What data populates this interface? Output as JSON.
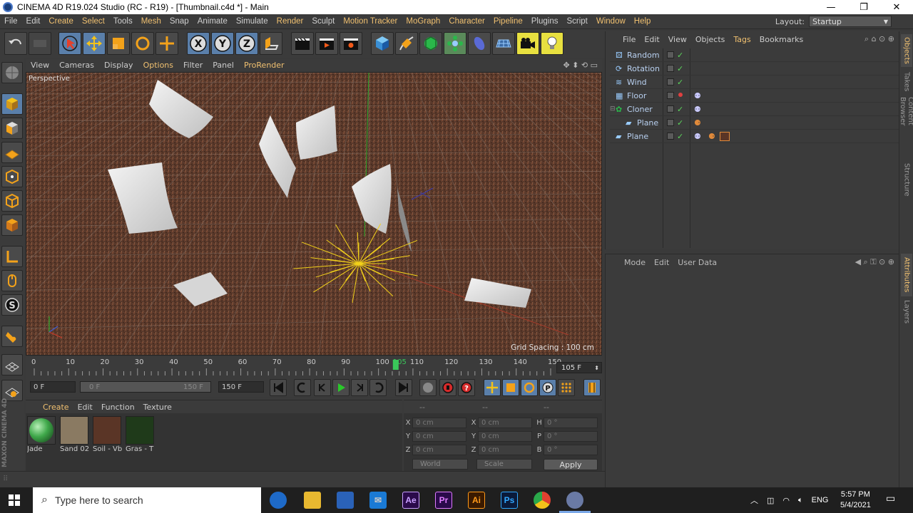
{
  "window": {
    "title": "CINEMA 4D R19.024 Studio (RC - R19) - [Thumbnail.c4d *] - Main",
    "min": "—",
    "max": "❐",
    "close": "✕"
  },
  "menu": {
    "items": [
      "File",
      "Edit",
      "Create",
      "Select",
      "Tools",
      "Mesh",
      "Snap",
      "Animate",
      "Simulate",
      "Render",
      "Sculpt",
      "Motion Tracker",
      "MoGraph",
      "Character",
      "Pipeline",
      "Plugins",
      "Script",
      "Window",
      "Help"
    ],
    "layout_label": "Layout:",
    "layout_value": "Startup"
  },
  "viewport": {
    "menu": [
      "View",
      "Cameras",
      "Display",
      "Options",
      "Filter",
      "Panel",
      "ProRender"
    ],
    "camera_label": "Perspective",
    "grid_spacing": "Grid Spacing : 100 cm"
  },
  "timeline": {
    "ticks": [
      "0",
      "10",
      "20",
      "30",
      "40",
      "50",
      "60",
      "70",
      "80",
      "90",
      "100",
      "105",
      "110",
      "120",
      "130",
      "140",
      "150"
    ],
    "current_frame_display": "105 F",
    "current_frame": 105,
    "max_frame": 150
  },
  "transport": {
    "start": "0 F",
    "range_start": "0 F",
    "range_end": "150 F",
    "end": "150 F"
  },
  "materials": {
    "menu": [
      "Create",
      "Edit",
      "Function",
      "Texture"
    ],
    "items": [
      {
        "label": "Jade",
        "color": "#3fa84a"
      },
      {
        "label": "Sand 02",
        "color": "#8a7a62"
      },
      {
        "label": "Soil - Vb",
        "color": "#5a3526"
      },
      {
        "label": "Gras - T",
        "color": "#1f3a1a"
      }
    ]
  },
  "coords": {
    "headers": [
      "--",
      "--",
      "--"
    ],
    "rows": [
      {
        "a": "X",
        "v1": "0 cm",
        "b": "X",
        "v2": "0 cm",
        "c": "H",
        "v3": "0 °"
      },
      {
        "a": "Y",
        "v1": "0 cm",
        "b": "Y",
        "v2": "0 cm",
        "c": "P",
        "v3": "0 °"
      },
      {
        "a": "Z",
        "v1": "0 cm",
        "b": "Z",
        "v2": "0 cm",
        "c": "B",
        "v3": "0 °"
      }
    ],
    "mode1": "World",
    "mode2": "Scale",
    "apply": "Apply"
  },
  "brand": "MAXON CINEMA 4D",
  "objects": {
    "menu": [
      "File",
      "Edit",
      "View",
      "Objects",
      "Tags",
      "Bookmarks"
    ],
    "rows": [
      {
        "name": "Random",
        "indent": 0
      },
      {
        "name": "Rotation",
        "indent": 0
      },
      {
        "name": "Wind",
        "indent": 0
      },
      {
        "name": "Floor",
        "indent": 0
      },
      {
        "name": "Cloner",
        "indent": 0
      },
      {
        "name": "Plane",
        "indent": 1
      },
      {
        "name": "Plane",
        "indent": 0
      }
    ]
  },
  "attributes": {
    "menu": [
      "Mode",
      "Edit",
      "User Data"
    ]
  },
  "right_tabs": [
    "Objects",
    "Takes",
    "Content Browser",
    "Structure",
    "Attributes",
    "Layers"
  ],
  "taskbar": {
    "search_placeholder": "Type here to search",
    "apps": [
      {
        "label": "Ae",
        "color": "#2a0a4a",
        "fg": "#c9a0ff"
      },
      {
        "label": "Pr",
        "color": "#2a0a4a",
        "fg": "#e07cff"
      },
      {
        "label": "Ai",
        "color": "#3a1a00",
        "fg": "#ff9a1a"
      },
      {
        "label": "Ps",
        "color": "#0a1a3a",
        "fg": "#31a8ff"
      }
    ],
    "lang": "ENG",
    "time": "5:57 PM",
    "date": "5/4/2021"
  },
  "colors": {
    "accent": "#f0c070",
    "floor": "#5a3a2c",
    "selection": "#5a7faa"
  }
}
